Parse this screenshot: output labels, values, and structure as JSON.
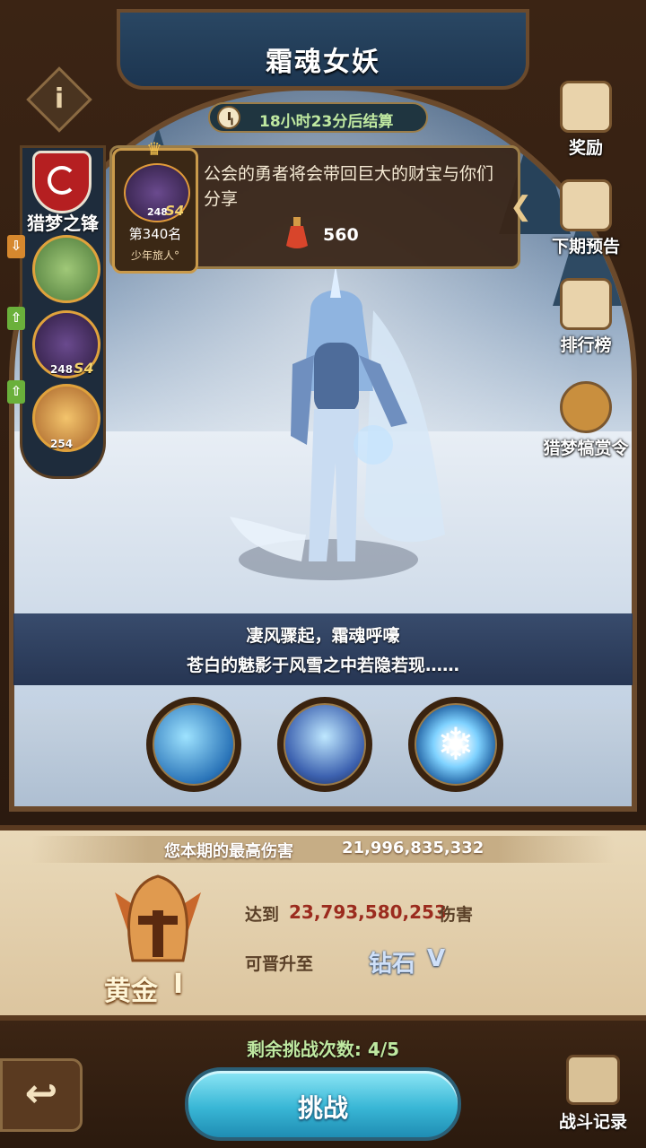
{
  "boss": {
    "title": "霜魂女妖"
  },
  "timer": {
    "text": "18小时23分后结算"
  },
  "info_panel": {
    "rank_text": "第340名",
    "player_name": "少年旅人°",
    "hero_level": "248",
    "hero_tier": "S4",
    "description": "公会的勇者将会带回巨大的财宝与你们分享",
    "reward_amount": "560"
  },
  "guild": {
    "name": "猎梦之锋",
    "members": [
      {
        "level": "",
        "tag": "down"
      },
      {
        "level": "248",
        "tier": "S4",
        "tag": "up"
      },
      {
        "level": "254",
        "tag": "up"
      }
    ]
  },
  "side_menu": {
    "rewards": "奖励",
    "next_preview": "下期预告",
    "leaderboard": "排行榜",
    "pass": "猎梦犒赏令"
  },
  "story": {
    "line1": "凄风骤起，霜魂呼嚎",
    "line2": "苍白的魅影于风雪之中若隐若现……"
  },
  "skills": [
    "ice-dash-skill",
    "frost-blade-skill",
    "snowflake-orb-skill"
  ],
  "damage": {
    "best_label": "您本期的最高伤害",
    "best_value": "21,996,835,332",
    "reach_prefix": "达到",
    "target_value": "23,793,580,253",
    "reach_suffix": "伤害",
    "promote_label": "可晋升至",
    "current_rank_name": "黄金",
    "current_rank_tier": "I",
    "next_rank_name": "钻石",
    "next_rank_tier": "V"
  },
  "footer": {
    "remaining": "剩余挑战次数: 4/5",
    "challenge_label": "挑战",
    "record_label": "战斗记录"
  },
  "colors": {
    "frame_brown": "#3b2414",
    "challenge_cyan": "#39b7d6",
    "highlight_green": "#bfe8a0",
    "target_red": "#9b2b1e"
  }
}
